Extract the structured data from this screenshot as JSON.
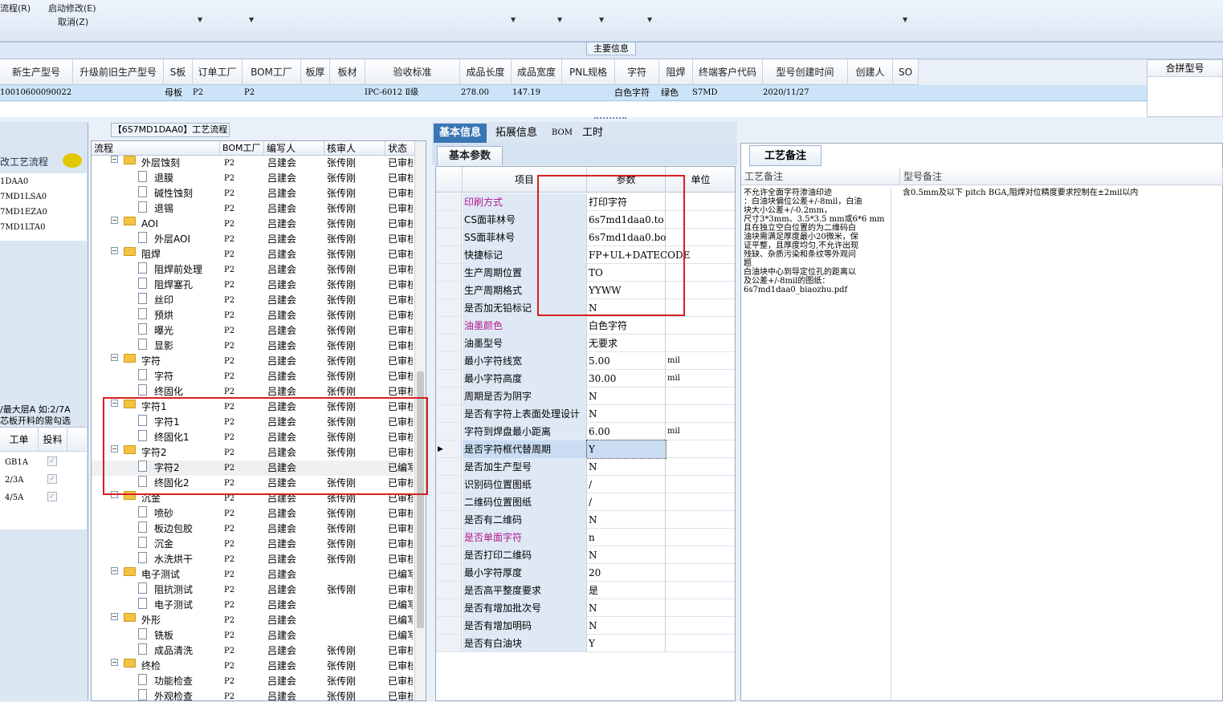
{
  "ribbon": {
    "item1": "流程(R)",
    "item2": "启动修改(E)",
    "item3": "取消(Z)"
  },
  "main_info_title": "主要信息",
  "main_columns": [
    "新生产型号",
    "升级前旧生产型号",
    "S板",
    "订单工厂",
    "BOM工厂",
    "板厚",
    "板材",
    "验收标准",
    "成品长度",
    "成品宽度",
    "PNL规格",
    "字符",
    "阻焊",
    "终端客户代码",
    "型号创建时间",
    "创建人",
    "SO"
  ],
  "main_row": {
    "model": "10010600090022",
    "s_board": "母板",
    "order_factory": "P2",
    "bom_factory": "P2",
    "standard": "IPC-6012 Ⅱ级",
    "length": "278.00",
    "width": "147.19",
    "char": "白色字符",
    "solder": "绿色",
    "customer": "S7MD",
    "created": "2020/11/27"
  },
  "merge_model_header": "合拼型号",
  "left_panel": {
    "title": "改工艺流程",
    "codes": [
      "1DAA0",
      "7MD1LSA0",
      "7MD1EZA0",
      "7MD1LTA0"
    ],
    "note1": "/最大层A 如:2/7A",
    "note2": "芯板开料的需勾选",
    "col_work": "工单",
    "col_feed": "投料",
    "rows": [
      "GB1A",
      "2/3A",
      "4/5A"
    ]
  },
  "flow": {
    "title": "【6S7MD1DAA0】工艺流程",
    "headers": [
      "流程",
      "BOM工厂",
      "编写人",
      "核审人",
      "状态"
    ],
    "rows": [
      {
        "name": "外层蚀刻",
        "folder": true,
        "bom": "P2",
        "writer": "吕建会",
        "reviewer": "张传刚",
        "status": "已审核"
      },
      {
        "name": "退膜",
        "folder": false,
        "bom": "P2",
        "writer": "吕建会",
        "reviewer": "张传刚",
        "status": "已审核"
      },
      {
        "name": "碱性蚀刻",
        "folder": false,
        "bom": "P2",
        "writer": "吕建会",
        "reviewer": "张传刚",
        "status": "已审核"
      },
      {
        "name": "退锡",
        "folder": false,
        "bom": "P2",
        "writer": "吕建会",
        "reviewer": "张传刚",
        "status": "已审核"
      },
      {
        "name": "AOI",
        "folder": true,
        "bom": "P2",
        "writer": "吕建会",
        "reviewer": "张传刚",
        "status": "已审核"
      },
      {
        "name": "外层AOI",
        "folder": false,
        "bom": "P2",
        "writer": "吕建会",
        "reviewer": "张传刚",
        "status": "已审核"
      },
      {
        "name": "阻焊",
        "folder": true,
        "bom": "P2",
        "writer": "吕建会",
        "reviewer": "张传刚",
        "status": "已审核"
      },
      {
        "name": "阻焊前处理",
        "folder": false,
        "bom": "P2",
        "writer": "吕建会",
        "reviewer": "张传刚",
        "status": "已审核"
      },
      {
        "name": "阻焊塞孔",
        "folder": false,
        "bom": "P2",
        "writer": "吕建会",
        "reviewer": "张传刚",
        "status": "已审核"
      },
      {
        "name": "丝印",
        "folder": false,
        "bom": "P2",
        "writer": "吕建会",
        "reviewer": "张传刚",
        "status": "已审核"
      },
      {
        "name": "预烘",
        "folder": false,
        "bom": "P2",
        "writer": "吕建会",
        "reviewer": "张传刚",
        "status": "已审核"
      },
      {
        "name": "曝光",
        "folder": false,
        "bom": "P2",
        "writer": "吕建会",
        "reviewer": "张传刚",
        "status": "已审核"
      },
      {
        "name": "显影",
        "folder": false,
        "bom": "P2",
        "writer": "吕建会",
        "reviewer": "张传刚",
        "status": "已审核"
      },
      {
        "name": "字符",
        "folder": true,
        "bom": "P2",
        "writer": "吕建会",
        "reviewer": "张传刚",
        "status": "已审核"
      },
      {
        "name": "字符",
        "folder": false,
        "bom": "P2",
        "writer": "吕建会",
        "reviewer": "张传刚",
        "status": "已审核"
      },
      {
        "name": "终固化",
        "folder": false,
        "bom": "P2",
        "writer": "吕建会",
        "reviewer": "张传刚",
        "status": "已审核"
      },
      {
        "name": "字符1",
        "folder": true,
        "bom": "P2",
        "writer": "吕建会",
        "reviewer": "张传刚",
        "status": "已审核"
      },
      {
        "name": "字符1",
        "folder": false,
        "bom": "P2",
        "writer": "吕建会",
        "reviewer": "张传刚",
        "status": "已审核"
      },
      {
        "name": "终固化1",
        "folder": false,
        "bom": "P2",
        "writer": "吕建会",
        "reviewer": "张传刚",
        "status": "已审核"
      },
      {
        "name": "字符2",
        "folder": true,
        "bom": "P2",
        "writer": "吕建会",
        "reviewer": "张传刚",
        "status": "已审核"
      },
      {
        "name": "字符2",
        "folder": false,
        "bom": "P2",
        "writer": "吕建会",
        "reviewer": "",
        "status": "已编写"
      },
      {
        "name": "终固化2",
        "folder": false,
        "bom": "P2",
        "writer": "吕建会",
        "reviewer": "张传刚",
        "status": "已审核"
      },
      {
        "name": "沉金",
        "folder": true,
        "bom": "P2",
        "writer": "吕建会",
        "reviewer": "张传刚",
        "status": "已审核"
      },
      {
        "name": "喷砂",
        "folder": false,
        "bom": "P2",
        "writer": "吕建会",
        "reviewer": "张传刚",
        "status": "已审核"
      },
      {
        "name": "板边包胶",
        "folder": false,
        "bom": "P2",
        "writer": "吕建会",
        "reviewer": "张传刚",
        "status": "已审核"
      },
      {
        "name": "沉金",
        "folder": false,
        "bom": "P2",
        "writer": "吕建会",
        "reviewer": "张传刚",
        "status": "已审核"
      },
      {
        "name": "水洗烘干",
        "folder": false,
        "bom": "P2",
        "writer": "吕建会",
        "reviewer": "张传刚",
        "status": "已审核"
      },
      {
        "name": "电子测试",
        "folder": true,
        "bom": "P2",
        "writer": "吕建会",
        "reviewer": "",
        "status": "已编写"
      },
      {
        "name": "阻抗测试",
        "folder": false,
        "bom": "P2",
        "writer": "吕建会",
        "reviewer": "张传刚",
        "status": "已审核"
      },
      {
        "name": "电子测试",
        "folder": false,
        "bom": "P2",
        "writer": "吕建会",
        "reviewer": "",
        "status": "已编写"
      },
      {
        "name": "外形",
        "folder": true,
        "bom": "P2",
        "writer": "吕建会",
        "reviewer": "",
        "status": "已编写"
      },
      {
        "name": "铣板",
        "folder": false,
        "bom": "P2",
        "writer": "吕建会",
        "reviewer": "",
        "status": "已编写"
      },
      {
        "name": "成品清洗",
        "folder": false,
        "bom": "P2",
        "writer": "吕建会",
        "reviewer": "张传刚",
        "status": "已审核"
      },
      {
        "name": "终检",
        "folder": true,
        "bom": "P2",
        "writer": "吕建会",
        "reviewer": "张传刚",
        "status": "已审核"
      },
      {
        "name": "功能检查",
        "folder": false,
        "bom": "P2",
        "writer": "吕建会",
        "reviewer": "张传刚",
        "status": "已审核"
      },
      {
        "name": "外观检查",
        "folder": false,
        "bom": "P2",
        "writer": "吕建会",
        "reviewer": "张传刚",
        "status": "已审核"
      }
    ]
  },
  "tabs": [
    "基本信息",
    "拓展信息",
    "BOM",
    "工时"
  ],
  "basic_params": {
    "section": "基本参数",
    "headers": [
      "项目",
      "参数",
      "单位"
    ],
    "rows": [
      {
        "item": "印刷方式",
        "value": "打印字符",
        "unit": "",
        "hl": true
      },
      {
        "item": "CS面菲林号",
        "value": "6s7md1daa0.to",
        "unit": "",
        "hl": false
      },
      {
        "item": "SS面菲林号",
        "value": "6s7md1daa0.bo",
        "unit": "",
        "hl": false
      },
      {
        "item": "快捷标记",
        "value": "FP+UL+DATECODE",
        "unit": "",
        "hl": false
      },
      {
        "item": "生产周期位置",
        "value": "TO",
        "unit": "",
        "hl": false
      },
      {
        "item": "生产周期格式",
        "value": "YYWW",
        "unit": "",
        "hl": false
      },
      {
        "item": "是否加无铅标记",
        "value": "N",
        "unit": "",
        "hl": false
      },
      {
        "item": "油墨颜色",
        "value": "白色字符",
        "unit": "",
        "hl": true
      },
      {
        "item": "油墨型号",
        "value": "无要求",
        "unit": "",
        "hl": false
      },
      {
        "item": "最小字符线宽",
        "value": "5.00",
        "unit": "mil",
        "hl": false
      },
      {
        "item": "最小字符高度",
        "value": "30.00",
        "unit": "mil",
        "hl": false
      },
      {
        "item": "周期是否为阴字",
        "value": "N",
        "unit": "",
        "hl": false
      },
      {
        "item": "是否有字符上表面处理设计",
        "value": "N",
        "unit": "",
        "hl": false
      },
      {
        "item": "字符到焊盘最小距离",
        "value": "6.00",
        "unit": "mil",
        "hl": false
      },
      {
        "item": "是否字符框代替周期",
        "value": "Y",
        "unit": "",
        "hl": false
      },
      {
        "item": "是否加生产型号",
        "value": "N",
        "unit": "",
        "hl": false
      },
      {
        "item": "识别码位置图纸",
        "value": "/",
        "unit": "",
        "hl": false
      },
      {
        "item": "二维码位置图纸",
        "value": "/",
        "unit": "",
        "hl": false
      },
      {
        "item": "是否有二维码",
        "value": "N",
        "unit": "",
        "hl": false
      },
      {
        "item": "是否单面字符",
        "value": "n",
        "unit": "",
        "hl": true
      },
      {
        "item": "是否打印二维码",
        "value": "N",
        "unit": "",
        "hl": false
      },
      {
        "item": "最小字符厚度",
        "value": "20",
        "unit": "",
        "hl": false
      },
      {
        "item": "是否高平整度要求",
        "value": "是",
        "unit": "",
        "hl": false
      },
      {
        "item": "是否有增加批次号",
        "value": "N",
        "unit": "",
        "hl": false
      },
      {
        "item": "是否有增加明码",
        "value": "N",
        "unit": "",
        "hl": false
      },
      {
        "item": "是否有白油块",
        "value": "Y",
        "unit": "",
        "hl": false
      }
    ]
  },
  "remarks": {
    "tab": "工艺备注",
    "col_process": "工艺备注",
    "col_model": "型号备注",
    "process_text": "不允许全面字符渗油印迹\n：白油块偏位公差+/-8mil，白油\n块大小公差+/-0.2mm，\n尺寸3*3mm、3.5*3.5 mm或6*6 mm\n且在独立空白位置的为二维码白\n油块需满足厚度最小20微米，保\n证平整，且厚度均匀,不允许出现\n残缺、杂质污染和条纹等外观问\n题\n白油块中心到导定位孔的距离以\n及公差+/-8mil的图纸：\n6s7md1daa0_biaozhu.pdf",
    "model_text": "含0.5mm及以下 pitch BGA,阻焊对位精度要求控制在±2mil以内"
  }
}
